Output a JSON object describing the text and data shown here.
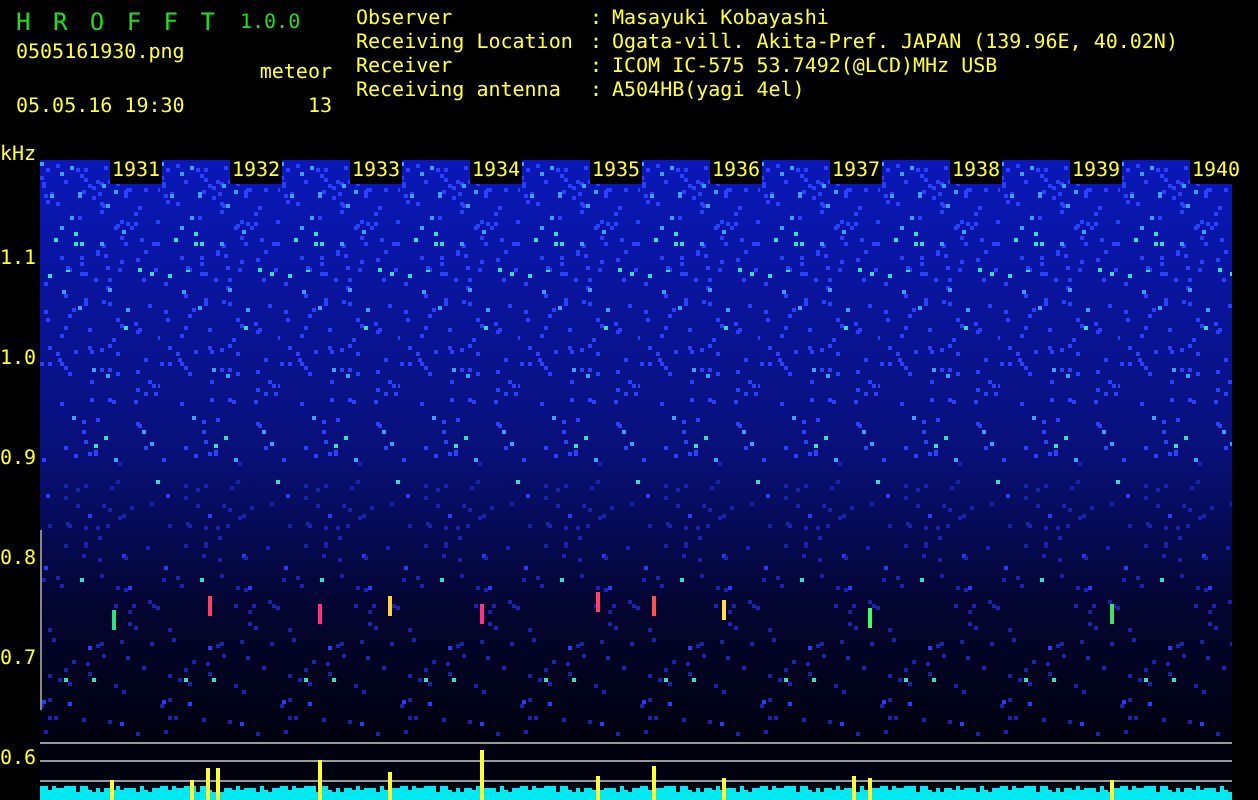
{
  "app": {
    "title": "H R O F F T",
    "version": "1.0.0"
  },
  "file": {
    "name": "0505161930.png",
    "datetime": "05.05.16 19:30"
  },
  "meteor": {
    "label": "meteor",
    "count": "13"
  },
  "info": [
    {
      "label": "Observer",
      "separator": ":",
      "value": "Masayuki Kobayashi"
    },
    {
      "label": "Receiving Location",
      "separator": ":",
      "value": "Ogata-vill. Akita-Pref. JAPAN (139.96E, 40.02N)"
    },
    {
      "label": "Receiver",
      "separator": ":",
      "value": "ICOM IC-575 53.7492(@LCD)MHz USB"
    },
    {
      "label": "Receiving antenna",
      "separator": ":",
      "value": "A504HB(yagi 4el)"
    }
  ],
  "spectrogram": {
    "unit": "kHz",
    "y_labels": [
      "1.1",
      "1.0",
      "0.9",
      "0.8",
      "0.7",
      "0.6"
    ],
    "time_labels": [
      "1931",
      "1932",
      "1933",
      "1934",
      "1935",
      "1936",
      "1937",
      "1938",
      "1939",
      "1940"
    ]
  }
}
